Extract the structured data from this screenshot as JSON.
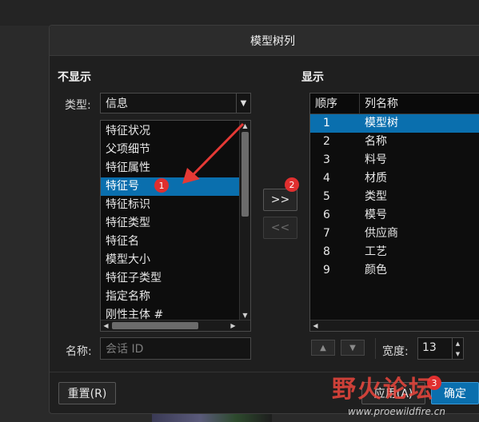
{
  "dialog": {
    "title": "模型树列"
  },
  "hidden_section": {
    "heading": "不显示",
    "type_label": "类型:",
    "type_value": "信息",
    "items": [
      "特征状况",
      "父项细节",
      "特征属性",
      "特征号",
      "特征标识",
      "特征类型",
      "特征名",
      "模型大小",
      "特征子类型",
      "指定名称",
      "刚性主体 #"
    ],
    "selected_index": 3,
    "name_label": "名称:",
    "name_placeholder": "会话 ID"
  },
  "transfer": {
    "add_label": ">>",
    "remove_label": "<<"
  },
  "shown_section": {
    "heading": "显示",
    "columns": [
      "顺序",
      "列名称"
    ],
    "rows": [
      {
        "order": "1",
        "name": "模型树"
      },
      {
        "order": "2",
        "name": "名称"
      },
      {
        "order": "3",
        "name": "料号"
      },
      {
        "order": "4",
        "name": "材质"
      },
      {
        "order": "5",
        "name": "类型"
      },
      {
        "order": "6",
        "name": "模号"
      },
      {
        "order": "7",
        "name": "供应商"
      },
      {
        "order": "8",
        "name": "工艺"
      },
      {
        "order": "9",
        "name": "颜色"
      }
    ],
    "selected_index": 0,
    "width_label": "宽度:",
    "width_value": "13"
  },
  "footer": {
    "reset_label": "重置(R)",
    "apply_label": "应用(A)",
    "ok_label": "确定"
  },
  "annotations": {
    "badge1": "1",
    "badge2": "2",
    "badge3": "3"
  },
  "watermark": {
    "site_cn": "野火论坛",
    "url": "www.proewildfire.cn"
  },
  "colors": {
    "selection": "#0a6fae",
    "badge": "#e02f2f",
    "arrow": "#e53935"
  }
}
